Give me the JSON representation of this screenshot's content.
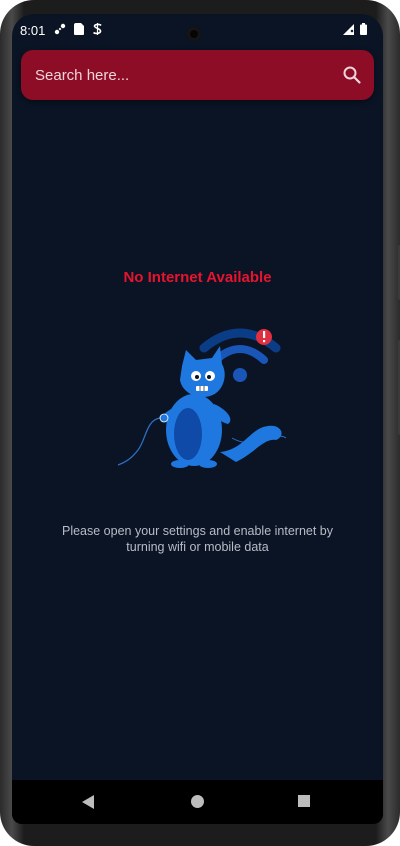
{
  "status_bar": {
    "time": "8:01",
    "left_icons": [
      "network-icon",
      "sim-card-icon",
      "vpn-icon"
    ],
    "right_icons": [
      "signal-icon",
      "battery-icon"
    ]
  },
  "search": {
    "placeholder": "Search here...",
    "icon": "search-icon"
  },
  "main": {
    "title": "No Internet Available",
    "message": "Please open your settings and enable internet by turning wifi or mobile data",
    "illustration": "cat-with-broken-wifi"
  },
  "nav_bar": {
    "buttons": [
      "back-icon",
      "home-icon",
      "recents-icon"
    ]
  },
  "colors": {
    "background": "#0a1424",
    "search_bar": "#8d0c26",
    "title": "#e8132f",
    "message": "#b7bcc6",
    "illustration_blue": "#1e78e0"
  }
}
